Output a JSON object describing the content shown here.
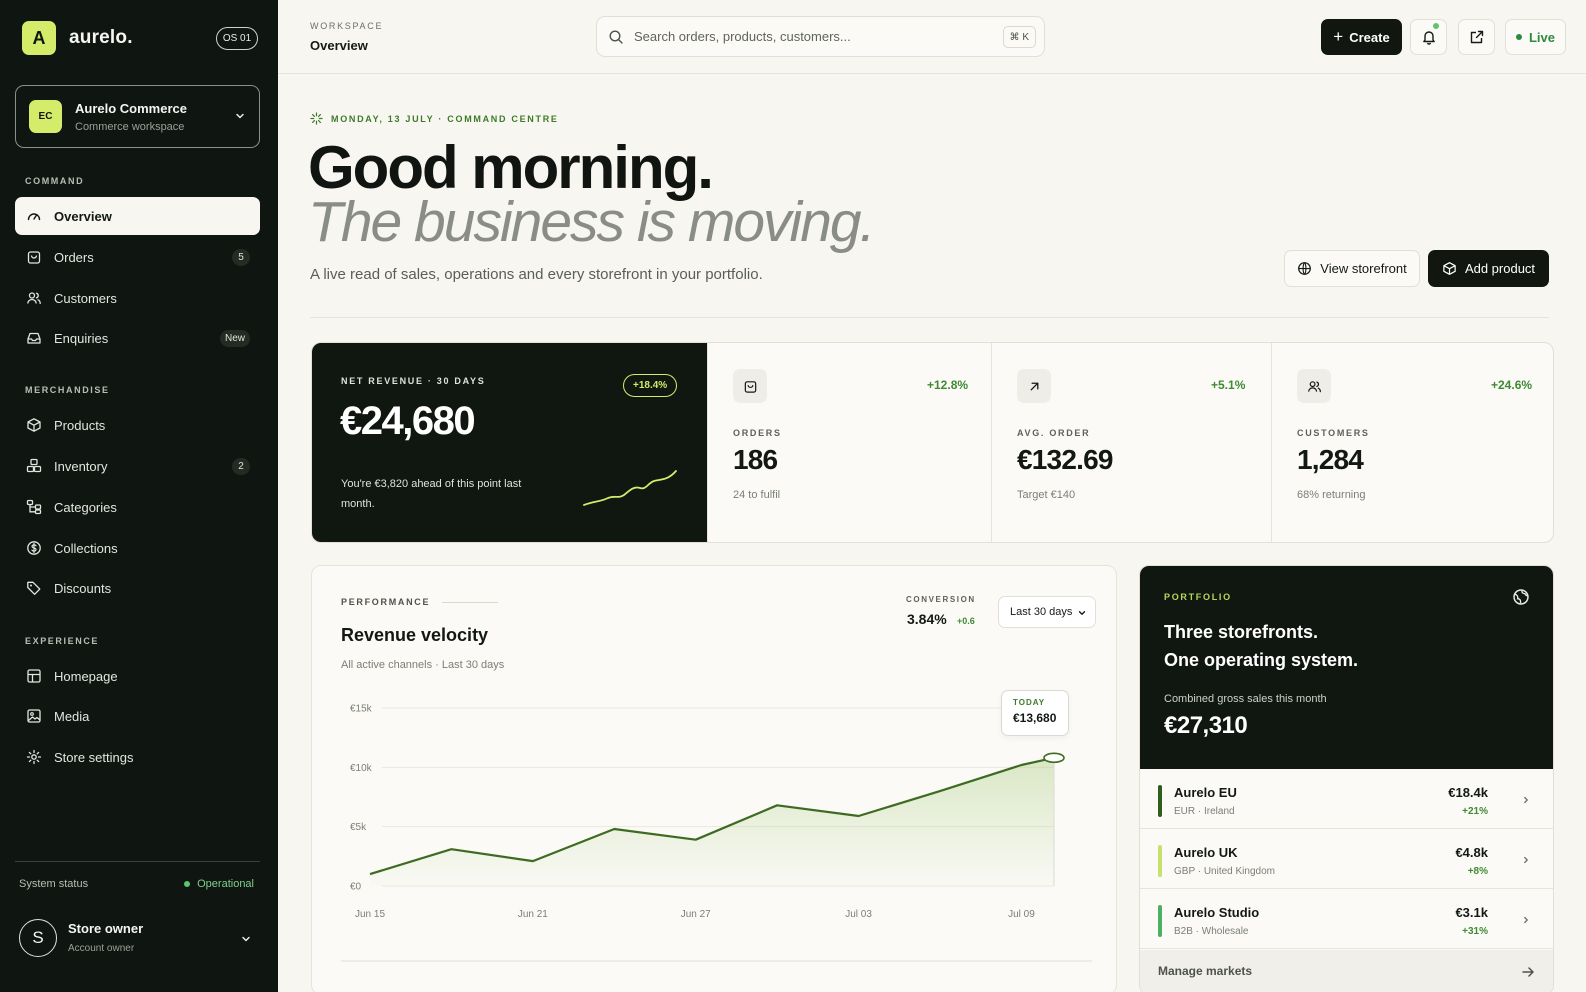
{
  "brand": {
    "logo_letter": "A",
    "name": "aurelo.",
    "os_label": "OS 01"
  },
  "workspace": {
    "initials": "EC",
    "name": "Aurelo Commerce",
    "subtitle": "Commerce workspace"
  },
  "nav": {
    "command_heading": "COMMAND",
    "command": [
      {
        "label": "Overview",
        "icon": "gauge-icon"
      },
      {
        "label": "Orders",
        "icon": "shopping-bag-icon",
        "badge": "5"
      },
      {
        "label": "Customers",
        "icon": "users-icon"
      },
      {
        "label": "Enquiries",
        "icon": "inbox-icon",
        "badge": "New"
      }
    ],
    "merch_heading": "MERCHANDISE",
    "merch": [
      {
        "label": "Products",
        "icon": "box-icon"
      },
      {
        "label": "Inventory",
        "icon": "boxes-icon",
        "badge": "2"
      },
      {
        "label": "Categories",
        "icon": "tree-icon"
      },
      {
        "label": "Collections",
        "icon": "coin-icon"
      },
      {
        "label": "Discounts",
        "icon": "tag-icon"
      }
    ],
    "exp_heading": "EXPERIENCE",
    "exp": [
      {
        "label": "Homepage",
        "icon": "layout-icon"
      },
      {
        "label": "Media",
        "icon": "image-icon"
      },
      {
        "label": "Store settings",
        "icon": "gear-icon"
      }
    ]
  },
  "system": {
    "label": "System status",
    "value": "Operational"
  },
  "user": {
    "initial": "S",
    "name": "Store owner",
    "role": "Account owner"
  },
  "topbar": {
    "crumb_small": "WORKSPACE",
    "crumb_main": "Overview",
    "search_placeholder": "Search orders, products, customers...",
    "shortcut": "⌘ K",
    "create_label": "Create",
    "live_label": "Live"
  },
  "hero": {
    "eyebrow": "MONDAY, 13 JULY · COMMAND CENTRE",
    "line1": "Good morning.",
    "line2": "The business is moving.",
    "subtitle": "A live read of sales, operations and every storefront in your portfolio.",
    "view_storefront": "View storefront",
    "add_product": "Add product"
  },
  "revenue": {
    "label": "NET REVENUE · 30 DAYS",
    "delta": "+18.4%",
    "value": "€24,680",
    "note": "You're €3,820 ahead of this point last month."
  },
  "kpis": [
    {
      "label": "ORDERS",
      "value": "186",
      "sub": "24 to fulfil",
      "delta": "+12.8%",
      "icon": "bag-icon"
    },
    {
      "label": "AVG. ORDER",
      "value": "€132.69",
      "sub": "Target €140",
      "delta": "+5.1%",
      "icon": "arrow-up-right-icon"
    },
    {
      "label": "CUSTOMERS",
      "value": "1,284",
      "sub": "68% returning",
      "delta": "+24.6%",
      "icon": "users-icon"
    }
  ],
  "performance": {
    "eyebrow": "PERFORMANCE",
    "title": "Revenue velocity",
    "subtitle": "All active channels · Last 30 days",
    "conversion_label": "CONVERSION",
    "conversion_value": "3.84%",
    "conversion_delta": "+0.6",
    "range": "Last 30 days",
    "tooltip_label": "TODAY",
    "tooltip_value": "€13,680"
  },
  "chart_data": {
    "type": "area",
    "x_ticks": [
      "Jun 15",
      "Jun 21",
      "Jun 27",
      "Jul 03",
      "Jul 09"
    ],
    "y_ticks": [
      "€0",
      "€5k",
      "€10k",
      "€15k"
    ],
    "ylim": [
      0,
      15000
    ],
    "x": [
      0,
      5,
      10,
      15,
      20,
      25,
      30,
      35,
      40,
      42
    ],
    "values": [
      1000,
      3100,
      2100,
      4800,
      3900,
      6800,
      5900,
      8000,
      10200,
      10800
    ],
    "series_color": "#3e6b22"
  },
  "portfolio": {
    "eyebrow": "PORTFOLIO",
    "title_1": "Three storefronts.",
    "title_2": "One operating system.",
    "caption": "Combined gross sales this month",
    "total": "€27,310",
    "markets": [
      {
        "name": "Aurelo EU",
        "sub": "EUR · Ireland",
        "value": "€18.4k",
        "delta": "+21%",
        "color": "#2f5d1e"
      },
      {
        "name": "Aurelo UK",
        "sub": "GBP · United Kingdom",
        "value": "€4.8k",
        "delta": "+8%",
        "color": "#c9e06a"
      },
      {
        "name": "Aurelo Studio",
        "sub": "B2B · Wholesale",
        "value": "€3.1k",
        "delta": "+31%",
        "color": "#4caf62"
      }
    ],
    "manage": "Manage markets"
  }
}
